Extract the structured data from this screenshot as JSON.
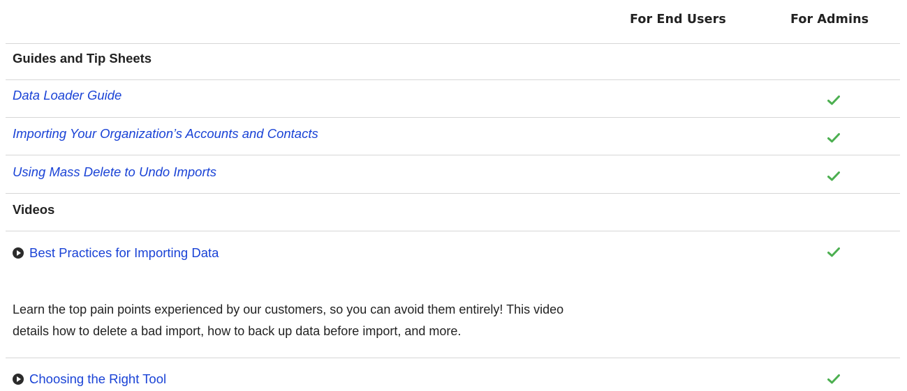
{
  "header": {
    "for_end_users": "For End Users",
    "for_admins": "For Admins"
  },
  "sections": {
    "guides": {
      "title": "Guides and Tip Sheets",
      "items": [
        {
          "label": "Data Loader Guide",
          "for_end_users": false,
          "for_admins": true
        },
        {
          "label": "Importing Your Organization’s Accounts and Contacts",
          "for_end_users": false,
          "for_admins": true
        },
        {
          "label": "Using Mass Delete to Undo Imports",
          "for_end_users": false,
          "for_admins": true
        }
      ]
    },
    "videos": {
      "title": "Videos",
      "items": [
        {
          "label": "Best Practices for Importing Data",
          "description": "Learn the top pain points experienced by our customers, so you can avoid them entirely! This video details how to delete a bad import, how to back up data before import, and more.",
          "for_end_users": false,
          "for_admins": true
        },
        {
          "label": "Choosing the Right Tool",
          "for_end_users": false,
          "for_admins": true
        }
      ]
    }
  },
  "icons": {
    "video": "play-icon",
    "available": "checkmark-icon"
  },
  "colors": {
    "link": "#1a43d6",
    "check": "#4caf50",
    "rule": "#d6d6d6"
  }
}
